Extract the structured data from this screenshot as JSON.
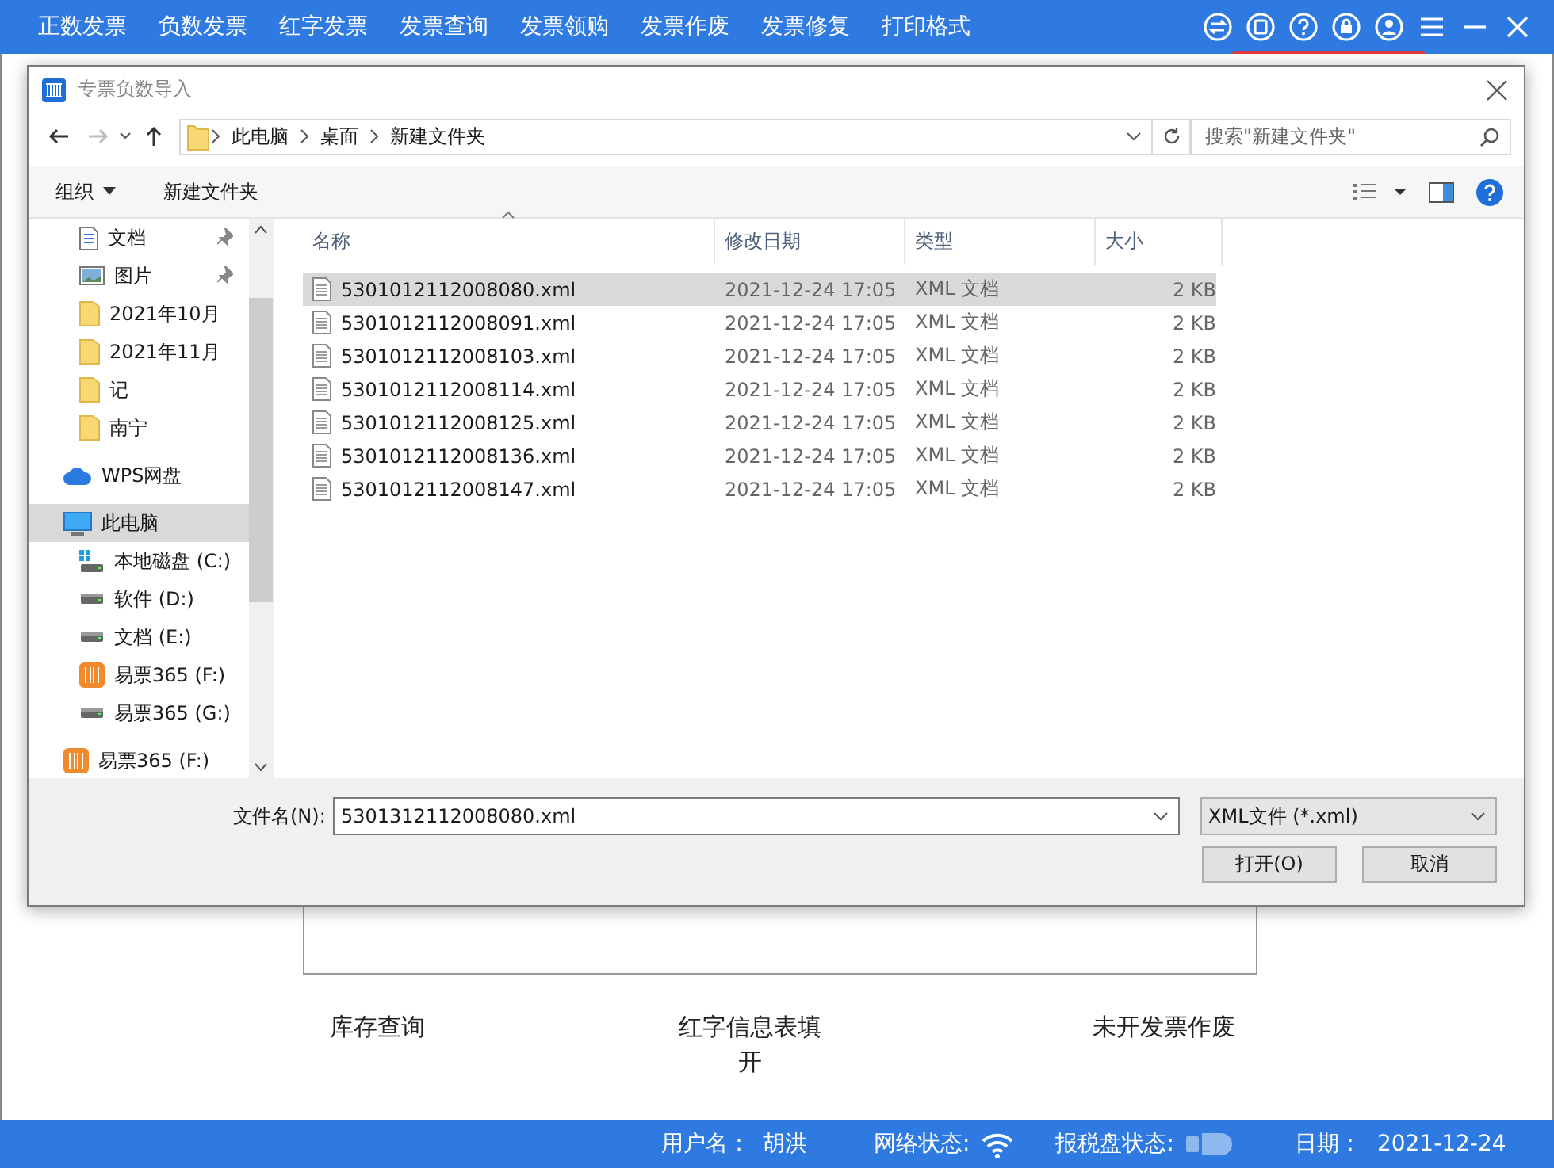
{
  "menu": [
    {
      "label": "正数发票"
    },
    {
      "label": "负数发票"
    },
    {
      "label": "红字发票"
    },
    {
      "label": "发票查询"
    },
    {
      "label": "发票领购"
    },
    {
      "label": "发票作废"
    },
    {
      "label": "发票修复"
    },
    {
      "label": "打印格式"
    }
  ],
  "dialog": {
    "title": "专票负数导入",
    "path": [
      "此电脑",
      "桌面",
      "新建文件夹"
    ],
    "search": {
      "placeholder": "搜索\"新建文件夹\""
    },
    "toolbar": [
      "组织",
      "新建文件夹"
    ],
    "quick_access": [
      {
        "label": "文档",
        "kind": "doc",
        "pinned": true,
        "selected": false
      },
      {
        "label": "图片",
        "kind": "picture",
        "pinned": true,
        "selected": false
      },
      {
        "label": "2021年10月",
        "kind": "folder",
        "pinned": false,
        "selected": false
      },
      {
        "label": "2021年11月",
        "kind": "folder",
        "pinned": false,
        "selected": false
      },
      {
        "label": "记",
        "kind": "folder",
        "pinned": false,
        "selected": false
      },
      {
        "label": "南宁",
        "kind": "folder",
        "pinned": false,
        "selected": false
      }
    ],
    "nav": [
      {
        "label": "WPS网盘",
        "kind": "cloud",
        "selected": false
      },
      {
        "label": "此电脑",
        "kind": "pc",
        "selected": true,
        "children": [
          {
            "label": "本地磁盘 (C:)",
            "kind": "windisk",
            "selected": false
          },
          {
            "label": "软件 (D:)",
            "kind": "disk",
            "selected": false
          },
          {
            "label": "文档 (E:)",
            "kind": "disk",
            "selected": false
          },
          {
            "label": "易票365 (F:)",
            "kind": "app",
            "selected": false
          },
          {
            "label": "易票365 (G:)",
            "kind": "disk",
            "selected": false
          }
        ]
      },
      {
        "label": "易票365 (F:)",
        "kind": "app",
        "selected": false
      }
    ],
    "columns": [
      "名称",
      "修改日期",
      "类型",
      "大小"
    ],
    "files": [
      {
        "name": "5301012112008080.xml",
        "date": "2021-12-24 17:05",
        "type": "XML 文档",
        "size": "2 KB",
        "selected": true
      },
      {
        "name": "5301012112008091.xml",
        "date": "2021-12-24 17:05",
        "type": "XML 文档",
        "size": "2 KB",
        "selected": false
      },
      {
        "name": "5301012112008103.xml",
        "date": "2021-12-24 17:05",
        "type": "XML 文档",
        "size": "2 KB",
        "selected": false
      },
      {
        "name": "5301012112008114.xml",
        "date": "2021-12-24 17:05",
        "type": "XML 文档",
        "size": "2 KB",
        "selected": false
      },
      {
        "name": "5301012112008125.xml",
        "date": "2021-12-24 17:05",
        "type": "XML 文档",
        "size": "2 KB",
        "selected": false
      },
      {
        "name": "5301012112008136.xml",
        "date": "2021-12-24 17:05",
        "type": "XML 文档",
        "size": "2 KB",
        "selected": false
      },
      {
        "name": "5301012112008147.xml",
        "date": "2021-12-24 17:05",
        "type": "XML 文档",
        "size": "2 KB",
        "selected": false
      }
    ],
    "filename_label": "文件名(N):",
    "filename": "5301312112008080.xml",
    "filetype": "XML文件 (*.xml)",
    "buttons": [
      "打开(O)",
      "取消"
    ]
  },
  "features": [
    {
      "label": "库存查询"
    },
    {
      "label": "红字信息表填开"
    },
    {
      "label": "未开发票作废"
    }
  ],
  "status_bar": {
    "user_label": "用户名：",
    "user": "胡洪",
    "network_label": "网络状态:",
    "disk_label": "报税盘状态:",
    "date_label": "日期：",
    "date": "2021-12-24"
  }
}
